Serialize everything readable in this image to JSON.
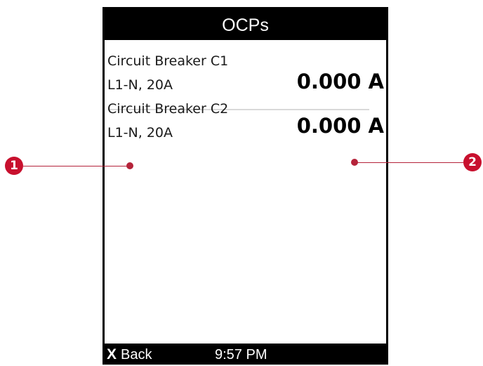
{
  "screen": {
    "title": "OCPs"
  },
  "ocps": [
    {
      "name": "Circuit Breaker C1",
      "spec": "L1-N, 20A",
      "reading": "0.000 A"
    },
    {
      "name": "Circuit Breaker C2",
      "spec": "L1-N, 20A",
      "reading": "0.000 A"
    }
  ],
  "soft_keys": {
    "back_icon": "X",
    "back_label": "Back",
    "clock": "9:57 PM"
  },
  "callouts": [
    {
      "number": "1"
    },
    {
      "number": "2"
    }
  ],
  "colors": {
    "screen_frame": "#000000",
    "screen_background": "#ffffff",
    "callout_accent": "#c8102e",
    "divider": "#d9d9d9"
  },
  "icons": {
    "back": "close-x-icon"
  }
}
